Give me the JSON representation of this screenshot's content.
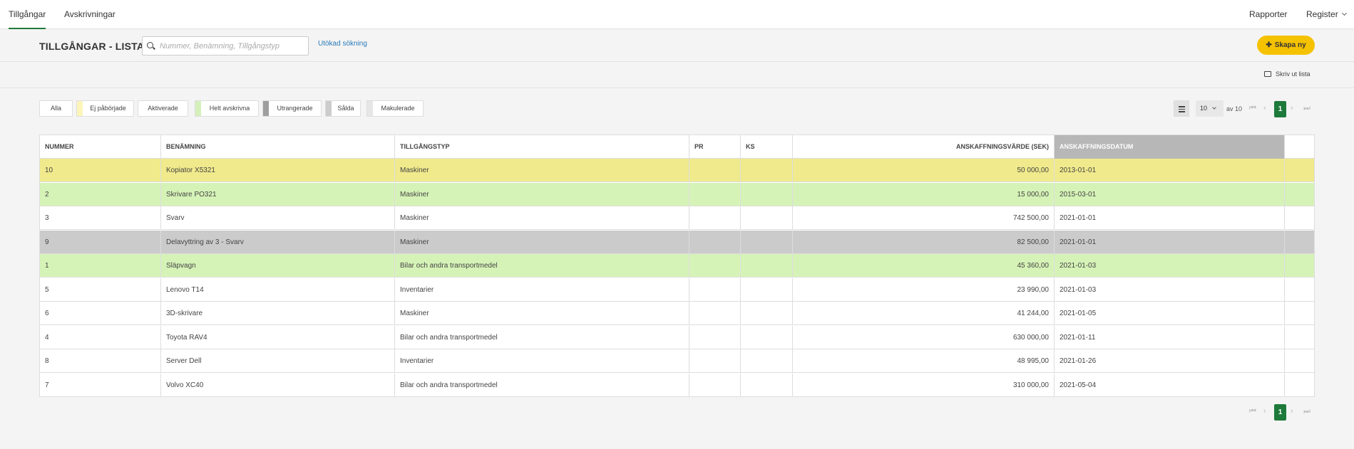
{
  "nav": {
    "tabs": [
      {
        "label": "Tillgångar",
        "active": true
      },
      {
        "label": "Avskrivningar",
        "active": false
      }
    ],
    "right": {
      "rapporter": "Rapporter",
      "register": "Register"
    }
  },
  "header": {
    "title": "TILLGÅNGAR - LISTA",
    "search_placeholder": "Nummer, Benämning, Tillgångstyp",
    "advanced_search": "Utökad sökning",
    "create_label": "Skapa ny",
    "print_label": "Skriv ut lista"
  },
  "filters": [
    {
      "label": "Alla",
      "color": ""
    },
    {
      "label": "Ej påbörjade",
      "color": "#fbf5b9"
    },
    {
      "label": "Aktiverade",
      "color": ""
    },
    {
      "label": "Helt avskrivna",
      "color": "#d6f0bb"
    },
    {
      "label": "Utrangerade",
      "color": "#9e9e9e"
    },
    {
      "label": "Sålda",
      "color": "#cccccc"
    },
    {
      "label": "Makulerade",
      "color": "#e6e6e6"
    }
  ],
  "pager": {
    "per_page": "10",
    "of_label": "av 10",
    "current_page": "1"
  },
  "table": {
    "columns": [
      "NUMMER",
      "BENÄMNING",
      "TILLGÅNGSTYP",
      "PR",
      "KS",
      "ANSKAFFNINGSVÄRDE (SEK)",
      "ANSKAFFNINGSDATUM",
      ""
    ],
    "rows": [
      {
        "nummer": "10",
        "benamning": "Kopiator X5321",
        "typ": "Maskiner",
        "pr": "",
        "ks": "",
        "varde": "50 000,00",
        "datum": "2013-01-01",
        "color": "#f0ea8c"
      },
      {
        "nummer": "2",
        "benamning": "Skrivare PO321",
        "typ": "Maskiner",
        "pr": "",
        "ks": "",
        "varde": "15 000,00",
        "datum": "2015-03-01",
        "color": "#d6f3b7"
      },
      {
        "nummer": "3",
        "benamning": "Svarv",
        "typ": "Maskiner",
        "pr": "",
        "ks": "",
        "varde": "742 500,00",
        "datum": "2021-01-01",
        "color": "#ffffff"
      },
      {
        "nummer": "9",
        "benamning": "Delavyttring av 3 - Svarv",
        "typ": "Maskiner",
        "pr": "",
        "ks": "",
        "varde": "82 500,00",
        "datum": "2021-01-01",
        "color": "#cbcbcb"
      },
      {
        "nummer": "1",
        "benamning": "Släpvagn",
        "typ": "Bilar och andra transportmedel",
        "pr": "",
        "ks": "",
        "varde": "45 360,00",
        "datum": "2021-01-03",
        "color": "#d6f3b7"
      },
      {
        "nummer": "5",
        "benamning": "Lenovo T14",
        "typ": "Inventarier",
        "pr": "",
        "ks": "",
        "varde": "23 990,00",
        "datum": "2021-01-03",
        "color": "#ffffff"
      },
      {
        "nummer": "6",
        "benamning": "3D-skrivare",
        "typ": "Maskiner",
        "pr": "",
        "ks": "",
        "varde": "41 244,00",
        "datum": "2021-01-05",
        "color": "#ffffff"
      },
      {
        "nummer": "4",
        "benamning": "Toyota RAV4",
        "typ": "Bilar och andra transportmedel",
        "pr": "",
        "ks": "",
        "varde": "630 000,00",
        "datum": "2021-01-11",
        "color": "#ffffff"
      },
      {
        "nummer": "8",
        "benamning": "Server Dell",
        "typ": "Inventarier",
        "pr": "",
        "ks": "",
        "varde": "48 995,00",
        "datum": "2021-01-26",
        "color": "#ffffff"
      },
      {
        "nummer": "7",
        "benamning": "Volvo XC40",
        "typ": "Bilar och andra transportmedel",
        "pr": "",
        "ks": "",
        "varde": "310 000,00",
        "datum": "2021-05-04",
        "color": "#ffffff"
      }
    ]
  }
}
